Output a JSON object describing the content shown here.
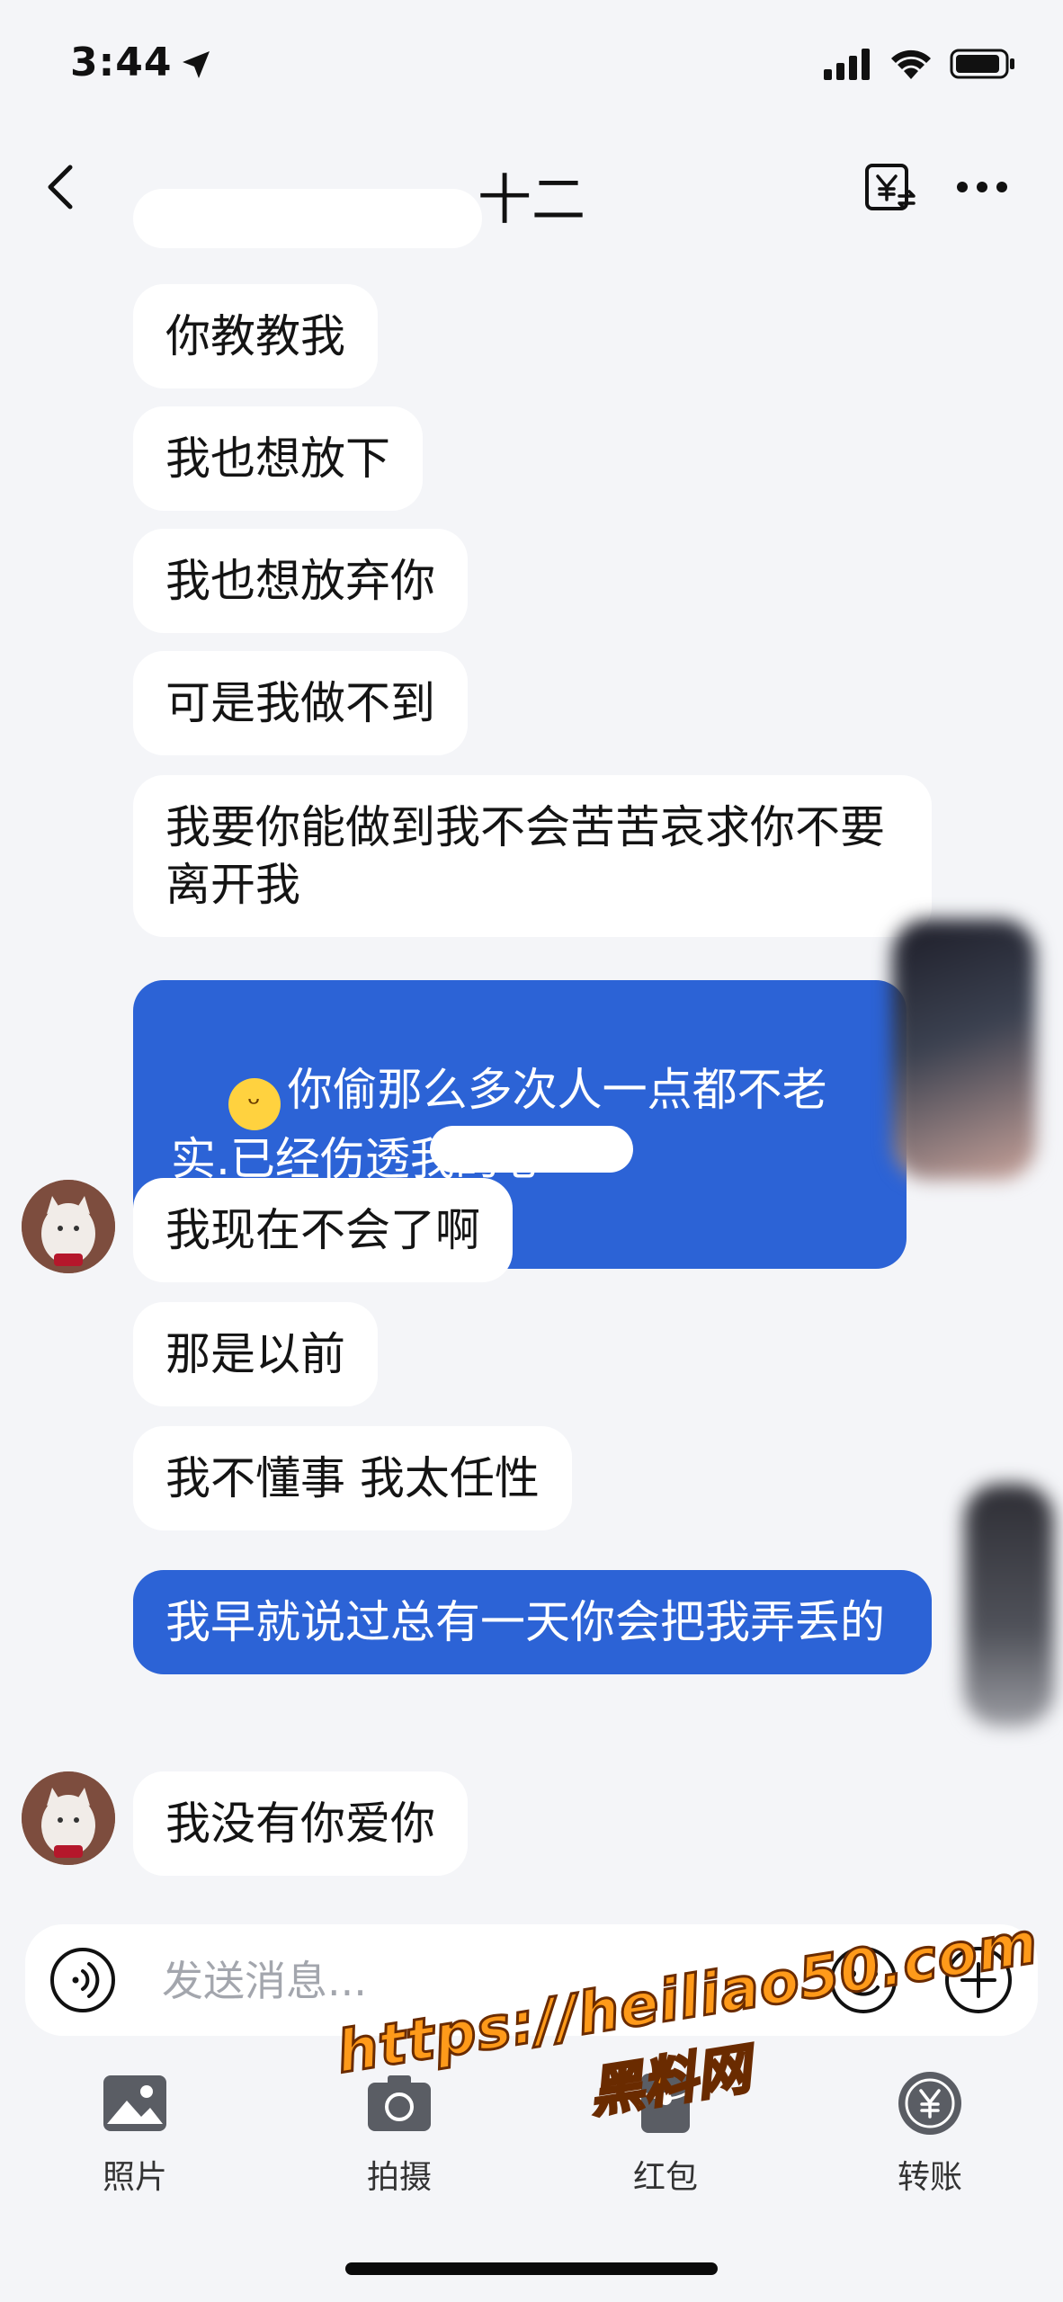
{
  "status_bar": {
    "time": "3:44"
  },
  "header": {
    "title": "十二",
    "back_icon": "chevron-left-icon",
    "transfer_icon": "yuan-transfer-icon",
    "more_icon": "more-dots-icon"
  },
  "messages": [
    {
      "side": "in",
      "text": "你教教我"
    },
    {
      "side": "in",
      "text": "我也想放下"
    },
    {
      "side": "in",
      "text": "我也想放弃你"
    },
    {
      "side": "in",
      "text": "可是我做不到"
    },
    {
      "side": "in",
      "text": "我要你能做到我不会苦苦哀求你不要离开我"
    },
    {
      "side": "out",
      "text": "你偷那么多次人一点都不老实.已经伤透我的心",
      "emoji": "😅"
    },
    {
      "side": "in",
      "text": "我现在不会了啊"
    },
    {
      "side": "in",
      "text": "那是以前"
    },
    {
      "side": "in",
      "text": "我不懂事 我太任性"
    },
    {
      "side": "out",
      "text": "我早就说过总有一天你会把我弄丢的"
    },
    {
      "side": "in",
      "text": "我没有你爱你"
    }
  ],
  "composer": {
    "placeholder": "发送消息..."
  },
  "toolbar": {
    "items": [
      {
        "label": "照片",
        "icon": "photo-icon"
      },
      {
        "label": "拍摄",
        "icon": "camera-icon"
      },
      {
        "label": "红包",
        "icon": "red-packet-icon"
      },
      {
        "label": "转账",
        "icon": "transfer-icon"
      }
    ]
  },
  "watermark": {
    "url": "https://heiliao50.com",
    "name": "黑料网"
  },
  "colors": {
    "outgoing_bubble": "#2c63d6",
    "incoming_bubble": "#ffffff",
    "background": "#f4f5f8",
    "watermark": "#ff9a1a"
  }
}
